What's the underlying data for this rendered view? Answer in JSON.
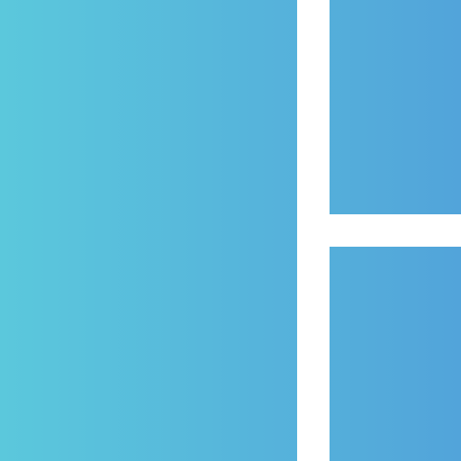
{
  "icon": {
    "name": "layout-grid-icon",
    "description_colors": {
      "gradient_start": "#5bc8dc",
      "gradient_end": "#52a4da",
      "background": "#ffffff"
    },
    "panels": [
      "large-panel",
      "top-right-panel",
      "bottom-right-panel"
    ]
  }
}
